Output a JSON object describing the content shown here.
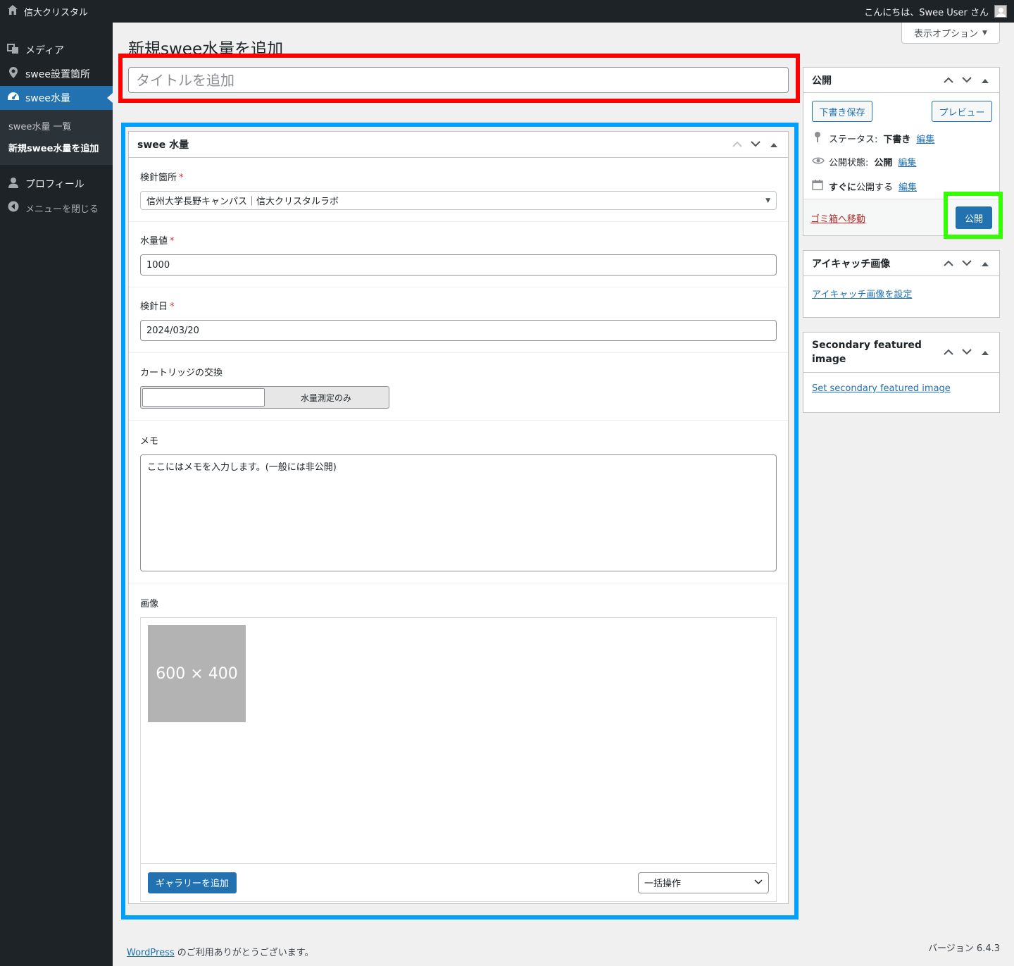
{
  "adminbar": {
    "site_name": "信大クリスタル",
    "greeting": "こんにちは、Swee User さん"
  },
  "sidebar": {
    "items": [
      {
        "label": "メディア"
      },
      {
        "label": "swee設置箇所"
      },
      {
        "label": "swee水量"
      },
      {
        "label": "プロフィール"
      },
      {
        "label": "メニューを閉じる"
      }
    ],
    "submenu": [
      {
        "label": "swee水量 一覧"
      },
      {
        "label": "新規swee水量を追加"
      }
    ]
  },
  "page": {
    "heading": "新規swee水量を追加",
    "screen_options": "表示オプション",
    "title_placeholder": "タイトルを追加"
  },
  "metabox": {
    "title": "swee 水量",
    "location_label": "検針箇所",
    "location_value": "信州大学長野キャンパス｜信大クリスタルラボ",
    "water_label": "水量値",
    "water_value": "1000",
    "date_label": "検針日",
    "date_value": "2024/03/20",
    "cartridge_label": "カートリッジの交換",
    "cartridge_toggle": "水量測定のみ",
    "memo_label": "メモ",
    "memo_value": "ここにはメモを入力します。(一般には非公開)",
    "image_label": "画像",
    "thumb_text": "600 × 400",
    "add_gallery": "ギャラリーを追加",
    "bulk_action": "一括操作",
    "required_mark": "*"
  },
  "publish": {
    "title": "公開",
    "save_draft": "下書き保存",
    "preview": "プレビュー",
    "status_label": "ステータス:",
    "status_value": "下書き",
    "visibility_label": "公開状態:",
    "visibility_value": "公開",
    "schedule_bold": "すぐに",
    "schedule_label": "公開する",
    "edit": "編集",
    "trash": "ゴミ箱へ移動",
    "publish_button": "公開"
  },
  "featured": {
    "title": "アイキャッチ画像",
    "link": "アイキャッチ画像を設定"
  },
  "secondary": {
    "title_line1": "Secondary featured",
    "title_line2": "image",
    "link": "Set secondary featured image"
  },
  "footer": {
    "wp_link": "WordPress",
    "thanks": " のご利用ありがとうございます。",
    "version": "バージョン 6.4.3"
  },
  "colors": {
    "admin_dark": "#1d2327",
    "accent": "#2271b1",
    "highlight_red": "#ff0000",
    "highlight_blue": "#00a0ff",
    "highlight_green": "#33ff00"
  }
}
